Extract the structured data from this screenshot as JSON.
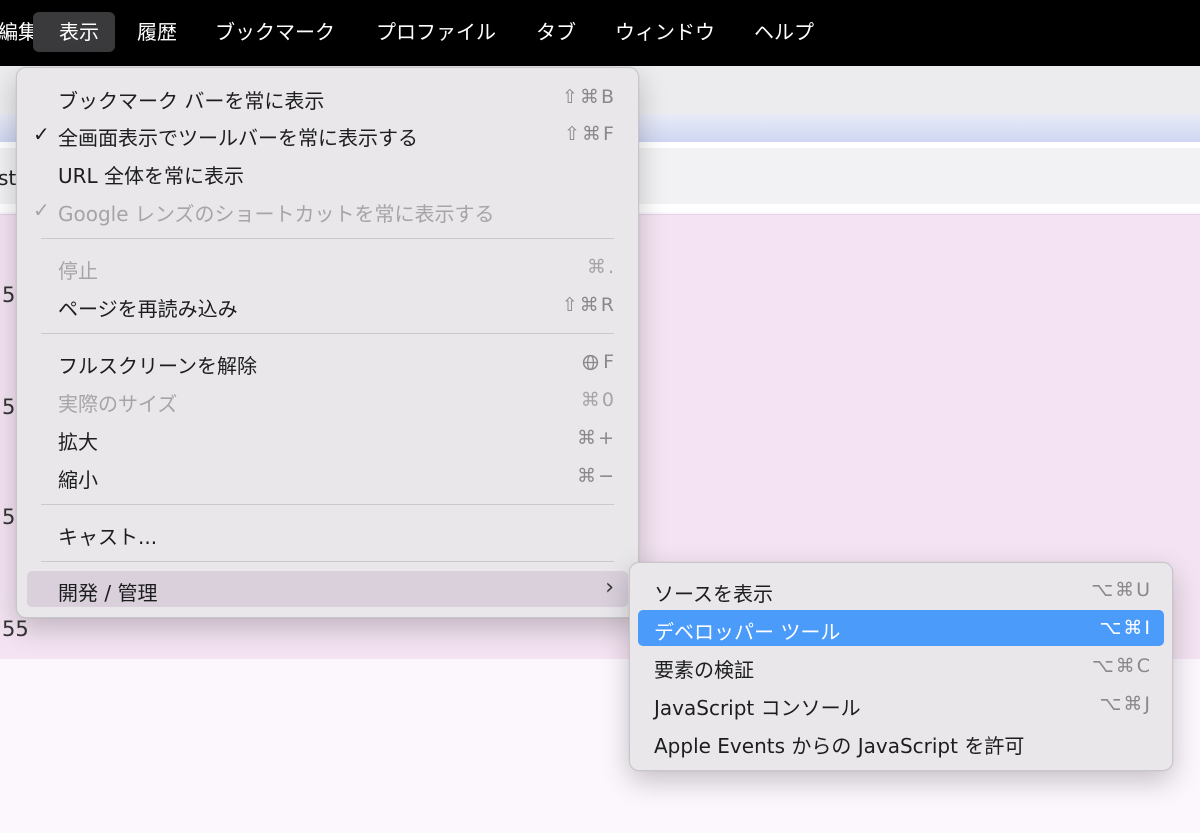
{
  "menubar": {
    "items": [
      {
        "label": "編集"
      },
      {
        "label": "表示"
      },
      {
        "label": "履歴"
      },
      {
        "label": "ブックマーク"
      },
      {
        "label": "プロファイル"
      },
      {
        "label": "タブ"
      },
      {
        "label": "ウィンドウ"
      },
      {
        "label": "ヘルプ"
      }
    ]
  },
  "page": {
    "address_fragment": "st",
    "rows": [
      "5",
      "5",
      "5",
      "55"
    ]
  },
  "view_menu": {
    "items": [
      {
        "label": "ブックマーク バーを常に表示",
        "shortcut": "⇧⌘B",
        "checked": false,
        "enabled": true
      },
      {
        "label": "全画面表示でツールバーを常に表示する",
        "shortcut": "⇧⌘F",
        "checked": true,
        "enabled": true
      },
      {
        "label": "URL 全体を常に表示",
        "shortcut": "",
        "checked": false,
        "enabled": true
      },
      {
        "label": "Google レンズのショートカットを常に表示する",
        "shortcut": "",
        "checked": true,
        "enabled": false
      },
      {
        "label": "停止",
        "shortcut": "⌘.",
        "checked": false,
        "enabled": false
      },
      {
        "label": "ページを再読み込み",
        "shortcut": "⇧⌘R",
        "checked": false,
        "enabled": true
      },
      {
        "label": "フルスクリーンを解除",
        "shortcut": "F",
        "shortcut_icon": "globe-icon",
        "checked": false,
        "enabled": true
      },
      {
        "label": "実際のサイズ",
        "shortcut": "⌘0",
        "checked": false,
        "enabled": false
      },
      {
        "label": "拡大",
        "shortcut": "⌘+",
        "checked": false,
        "enabled": true
      },
      {
        "label": "縮小",
        "shortcut": "⌘−",
        "checked": false,
        "enabled": true
      },
      {
        "label": "キャスト...",
        "shortcut": "",
        "checked": false,
        "enabled": true
      },
      {
        "label": "開発 / 管理",
        "shortcut": "",
        "submenu": true,
        "highlighted": true,
        "enabled": true
      }
    ],
    "check_mark": "✓",
    "submenu_chevron": "›"
  },
  "developer_submenu": {
    "items": [
      {
        "label": "ソースを表示",
        "shortcut": "⌥⌘U"
      },
      {
        "label": "デベロッパー ツール",
        "shortcut": "⌥⌘I",
        "selected": true
      },
      {
        "label": "要素の検証",
        "shortcut": "⌥⌘C"
      },
      {
        "label": "JavaScript コンソール",
        "shortcut": "⌥⌘J"
      },
      {
        "label": "Apple Events からの JavaScript を許可",
        "shortcut": ""
      }
    ]
  },
  "colors": {
    "menubar_bg": "#000000",
    "selection_blue": "#4b9bfb",
    "hover_row": "#d9d0dc",
    "content_pink": "#f4e4f3"
  }
}
